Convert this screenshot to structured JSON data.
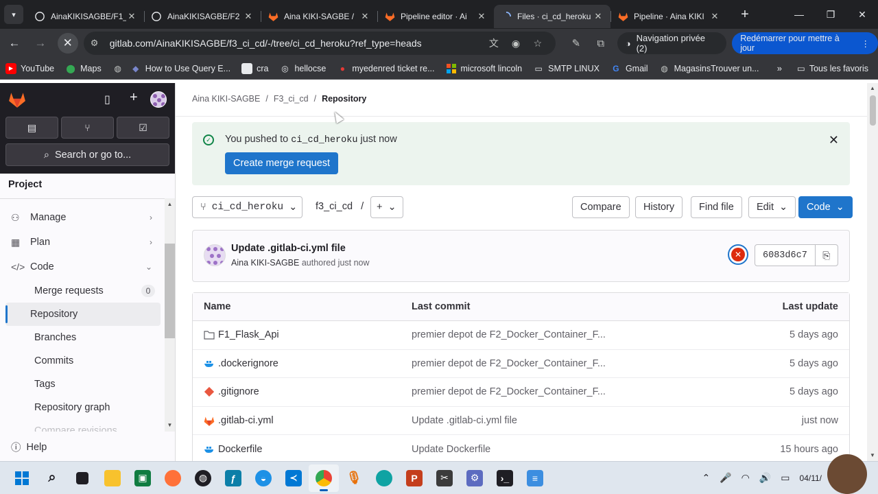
{
  "browser": {
    "tabs": [
      {
        "title": "AinaKIKISAGBE/F1_",
        "icon": "github-icon",
        "active": false
      },
      {
        "title": "AinaKIKISAGBE/F2",
        "icon": "github-icon",
        "active": false
      },
      {
        "title": "Aina KIKI-SAGBE /",
        "icon": "gitlab-icon",
        "active": false
      },
      {
        "title": "Pipeline editor · Ai",
        "icon": "gitlab-icon",
        "active": false
      },
      {
        "title": "Files · ci_cd_heroku",
        "icon": "loading-icon",
        "active": true
      },
      {
        "title": "Pipeline · Aina KIKI",
        "icon": "gitlab-icon",
        "active": false
      }
    ],
    "url": "gitlab.com/AinaKIKISAGBE/f3_ci_cd/-/tree/ci_cd_heroku?ref_type=heads",
    "private_label": "Navigation privée (2)",
    "restart_label": "Redémarrer pour mettre à jour",
    "bookmarks": [
      {
        "label": "YouTube",
        "icon": "youtube-icon",
        "color": "#ff0000"
      },
      {
        "label": "Maps",
        "icon": "maps-icon",
        "color": "#34a853"
      },
      {
        "label": "",
        "icon": "globe-icon",
        "color": "#9aa0a6"
      },
      {
        "label": "How to Use Query E...",
        "icon": "query-icon",
        "color": "#5c6bc0"
      },
      {
        "label": "cra",
        "icon": "page-icon",
        "color": "#9aa0a6"
      },
      {
        "label": "hellocse",
        "icon": "hellocse-icon",
        "color": "#9aa0a6"
      },
      {
        "label": "myedenred ticket re...",
        "icon": "edenred-icon",
        "color": "#e53935"
      },
      {
        "label": "microsoft lincoln",
        "icon": "microsoft-icon",
        "color": "#f25022"
      },
      {
        "label": "SMTP LINUX",
        "icon": "folder-icon",
        "color": "#9aa0a6"
      },
      {
        "label": "Gmail",
        "icon": "google-icon",
        "color": "#4285f4"
      },
      {
        "label": "MagasinsTrouver un...",
        "icon": "globe-icon",
        "color": "#9aa0a6"
      }
    ],
    "all_bookmarks_label": "Tous les favoris"
  },
  "sidebar": {
    "search_label": "Search or go to...",
    "context_title": "Project",
    "nav": [
      {
        "label": "Manage",
        "icon": "users-icon",
        "expanded": false
      },
      {
        "label": "Plan",
        "icon": "calendar-icon",
        "expanded": false
      },
      {
        "label": "Code",
        "icon": "code-icon",
        "expanded": true
      }
    ],
    "code_items": [
      {
        "label": "Merge requests",
        "badge": "0",
        "active": false
      },
      {
        "label": "Repository",
        "active": true
      },
      {
        "label": "Branches",
        "active": false
      },
      {
        "label": "Commits",
        "active": false
      },
      {
        "label": "Tags",
        "active": false
      },
      {
        "label": "Repository graph",
        "active": false
      },
      {
        "label": "Compare revisions",
        "active": false
      }
    ],
    "help_label": "Help"
  },
  "breadcrumb": [
    "Aina KIKI-SAGBE",
    "F3_ci_cd",
    "Repository"
  ],
  "alert": {
    "prefix": "You pushed to",
    "branch": "ci_cd_heroku",
    "suffix": "just now",
    "button": "Create merge request"
  },
  "tree_controls": {
    "branch": "ci_cd_heroku",
    "path": "f3_ci_cd",
    "compare": "Compare",
    "history": "History",
    "find_file": "Find file",
    "edit": "Edit",
    "code": "Code"
  },
  "last_commit": {
    "title": "Update .gitlab-ci.yml file",
    "author": "Aina KIKI-SAGBE",
    "authored": "authored just now",
    "sha": "6083d6c7",
    "pipeline_status": "failed"
  },
  "file_table": {
    "headers": {
      "name": "Name",
      "last_commit": "Last commit",
      "last_update": "Last update"
    },
    "rows": [
      {
        "name": "F1_Flask_Api",
        "icon": "folder-icon",
        "commit": "premier depot de F2_Docker_Container_F...",
        "updated": "5 days ago"
      },
      {
        "name": ".dockerignore",
        "icon": "docker-icon",
        "commit": "premier depot de F2_Docker_Container_F...",
        "updated": "5 days ago"
      },
      {
        "name": ".gitignore",
        "icon": "git-icon",
        "commit": "premier depot de F2_Docker_Container_F...",
        "updated": "5 days ago"
      },
      {
        "name": ".gitlab-ci.yml",
        "icon": "gitlab-icon",
        "commit": "Update .gitlab-ci.yml file",
        "updated": "just now"
      },
      {
        "name": "Dockerfile",
        "icon": "docker-icon",
        "commit": "Update Dockerfile",
        "updated": "15 hours ago"
      }
    ]
  },
  "taskbar": {
    "apps": [
      "start-icon",
      "search-icon",
      "taskview-icon",
      "file-explorer-icon",
      "app-icon",
      "firefox-icon",
      "github-desktop-icon",
      "app-icon",
      "docker-icon",
      "vscode-icon",
      "chrome-icon",
      "mic-app-icon",
      "edge-icon",
      "powerpoint-icon",
      "snipping-icon",
      "app-icon",
      "terminal-icon",
      "notepad-icon"
    ],
    "clock": "04/11/"
  }
}
